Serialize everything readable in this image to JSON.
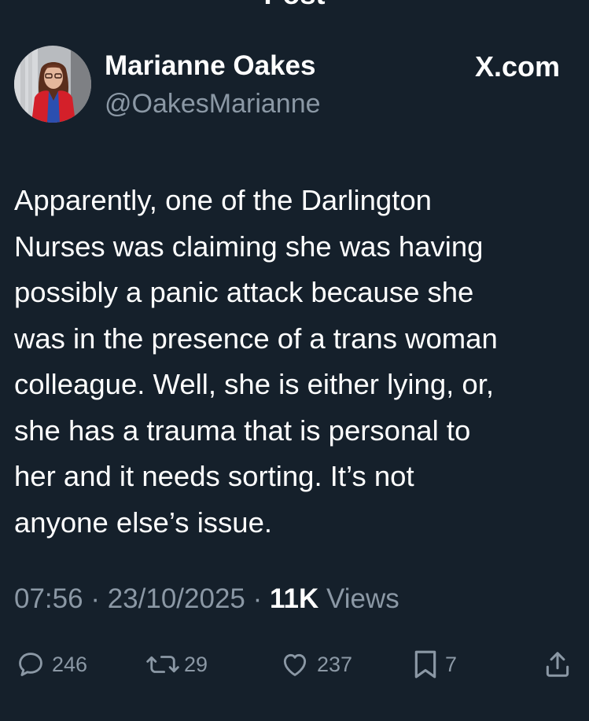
{
  "header": {
    "title": "Post"
  },
  "author": {
    "name": "Marianne Oakes",
    "handle": "@OakesMarianne"
  },
  "source_label": "X.com",
  "tweet": {
    "text": "Apparently, one of the Darlington\nNurses was claiming she was having\npossibly a panic attack because she\nwas in the presence of a trans woman\ncolleague. Well, she is either lying, or,\nshe has a trauma that is personal to\nher and  it needs sorting. It’s not\nanyone else’s issue.",
    "time": "07:56",
    "date": "23/10/2025",
    "views_count": "11K",
    "views_label": "Views",
    "separator": " · "
  },
  "actions": {
    "replies": "246",
    "reposts": "29",
    "likes": "237",
    "bookmarks": "7"
  },
  "icons": {
    "back": "back-arrow-icon",
    "reply": "reply-bubble-icon",
    "repost": "repost-arrows-icon",
    "like": "heart-icon",
    "bookmark": "bookmark-icon",
    "share": "share-upload-icon"
  },
  "colors": {
    "background": "#15202b",
    "text_primary": "#ffffff",
    "text_secondary": "#8b98a5"
  }
}
